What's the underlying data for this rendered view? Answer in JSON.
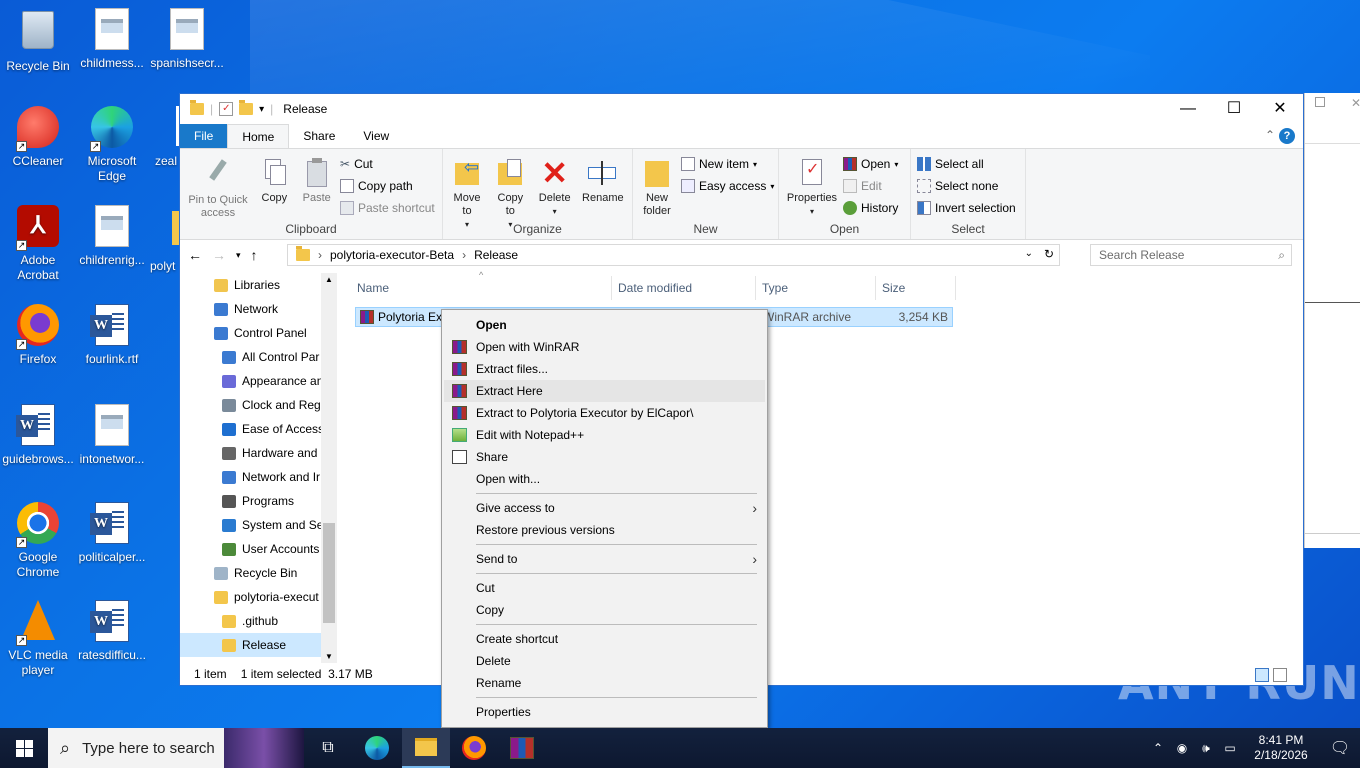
{
  "desktop": {
    "icons": [
      {
        "label": "Recycle Bin",
        "icon": "recycle-bin-icon"
      },
      {
        "label": "childmess...",
        "icon": "image-file-icon"
      },
      {
        "label": "spanishsecr...",
        "icon": "image-file-icon"
      },
      {
        "label": "CCleaner",
        "icon": "ccleaner-icon"
      },
      {
        "label": "Microsoft Edge",
        "icon": "edge-icon"
      },
      {
        "label": "zeal",
        "icon": "file-icon"
      },
      {
        "label": "Adobe Acrobat",
        "icon": "acrobat-icon"
      },
      {
        "label": "childrenrig...",
        "icon": "image-file-icon"
      },
      {
        "label": "polyt",
        "icon": "folder-icon"
      },
      {
        "label": "Firefox",
        "icon": "firefox-icon"
      },
      {
        "label": "fourlink.rtf",
        "icon": "word-doc-icon"
      },
      {
        "label": "guidebrows...",
        "icon": "word-doc-icon"
      },
      {
        "label": "intonetwor...",
        "icon": "image-file-icon"
      },
      {
        "label": "Google Chrome",
        "icon": "chrome-icon"
      },
      {
        "label": "politicalper...",
        "icon": "word-doc-icon"
      },
      {
        "label": "VLC media player",
        "icon": "vlc-icon"
      },
      {
        "label": "ratesdifficu...",
        "icon": "word-doc-icon"
      }
    ],
    "watermark": "ANY RUN"
  },
  "explorer": {
    "title": "Release",
    "tabs": [
      "File",
      "Home",
      "Share",
      "View"
    ],
    "ribbon": {
      "clipboard": {
        "label": "Clipboard",
        "pin": "Pin to Quick access",
        "copy": "Copy",
        "paste": "Paste",
        "cut": "Cut",
        "copy_path": "Copy path",
        "paste_shortcut": "Paste shortcut"
      },
      "organize": {
        "label": "Organize",
        "move_to": "Move to",
        "copy_to": "Copy to",
        "delete": "Delete",
        "rename": "Rename"
      },
      "new": {
        "label": "New",
        "new_folder": "New folder",
        "new_item": "New item",
        "easy_access": "Easy access"
      },
      "open": {
        "label": "Open",
        "properties": "Properties",
        "open": "Open",
        "edit": "Edit",
        "history": "History"
      },
      "select": {
        "label": "Select",
        "select_all": "Select all",
        "select_none": "Select none",
        "invert": "Invert selection"
      }
    },
    "address": {
      "crumbs": [
        "polytoria-executor-Beta",
        "Release"
      ],
      "search_placeholder": "Search Release"
    },
    "nav": [
      {
        "label": "Libraries",
        "icon": "libraries-icon",
        "indent": 0
      },
      {
        "label": "Network",
        "icon": "network-icon",
        "indent": 0
      },
      {
        "label": "Control Panel",
        "icon": "control-panel-icon",
        "indent": 0
      },
      {
        "label": "All Control Par",
        "icon": "control-panel-icon",
        "indent": 1
      },
      {
        "label": "Appearance an",
        "icon": "appearance-icon",
        "indent": 1
      },
      {
        "label": "Clock and Regi",
        "icon": "clock-icon",
        "indent": 1
      },
      {
        "label": "Ease of Access",
        "icon": "ease-of-access-icon",
        "indent": 1
      },
      {
        "label": "Hardware and",
        "icon": "hardware-icon",
        "indent": 1
      },
      {
        "label": "Network and Ir",
        "icon": "network-icon",
        "indent": 1
      },
      {
        "label": "Programs",
        "icon": "programs-icon",
        "indent": 1
      },
      {
        "label": "System and Sec",
        "icon": "system-icon",
        "indent": 1
      },
      {
        "label": "User Accounts",
        "icon": "users-icon",
        "indent": 1
      },
      {
        "label": "Recycle Bin",
        "icon": "recycle-bin-icon",
        "indent": 0
      },
      {
        "label": "polytoria-execut",
        "icon": "folder-icon",
        "indent": 0
      },
      {
        "label": ".github",
        "icon": "folder-icon",
        "indent": 1
      },
      {
        "label": "Release",
        "icon": "folder-icon",
        "indent": 1
      }
    ],
    "columns": [
      "Name",
      "Date modified",
      "Type",
      "Size"
    ],
    "file": {
      "name": "Polytoria Ex",
      "type": "WinRAR archive",
      "size": "3,254 KB"
    },
    "status": {
      "count": "1 item",
      "selected": "1 item selected  3.17 MB"
    }
  },
  "context_menu": [
    {
      "label": "Open",
      "bold": true
    },
    {
      "label": "Open with WinRAR",
      "icon": "winrar-icon"
    },
    {
      "label": "Extract files...",
      "icon": "winrar-icon"
    },
    {
      "label": "Extract Here",
      "icon": "winrar-icon",
      "highlighted": true
    },
    {
      "label": "Extract to Polytoria Executor by ElCapor\\",
      "icon": "winrar-icon"
    },
    {
      "label": "Edit with Notepad++",
      "icon": "notepadpp-icon"
    },
    {
      "label": "Share",
      "icon": "share-icon"
    },
    {
      "label": "Open with..."
    },
    {
      "sep": true
    },
    {
      "label": "Give access to",
      "submenu": true
    },
    {
      "label": "Restore previous versions"
    },
    {
      "sep": true
    },
    {
      "label": "Send to",
      "submenu": true
    },
    {
      "sep": true
    },
    {
      "label": "Cut"
    },
    {
      "label": "Copy"
    },
    {
      "sep": true
    },
    {
      "label": "Create shortcut"
    },
    {
      "label": "Delete"
    },
    {
      "label": "Rename"
    },
    {
      "sep": true
    },
    {
      "label": "Properties"
    }
  ],
  "taskbar": {
    "search_placeholder": "Type here to search",
    "time": "8:41 PM",
    "date": "2/18/2026"
  }
}
